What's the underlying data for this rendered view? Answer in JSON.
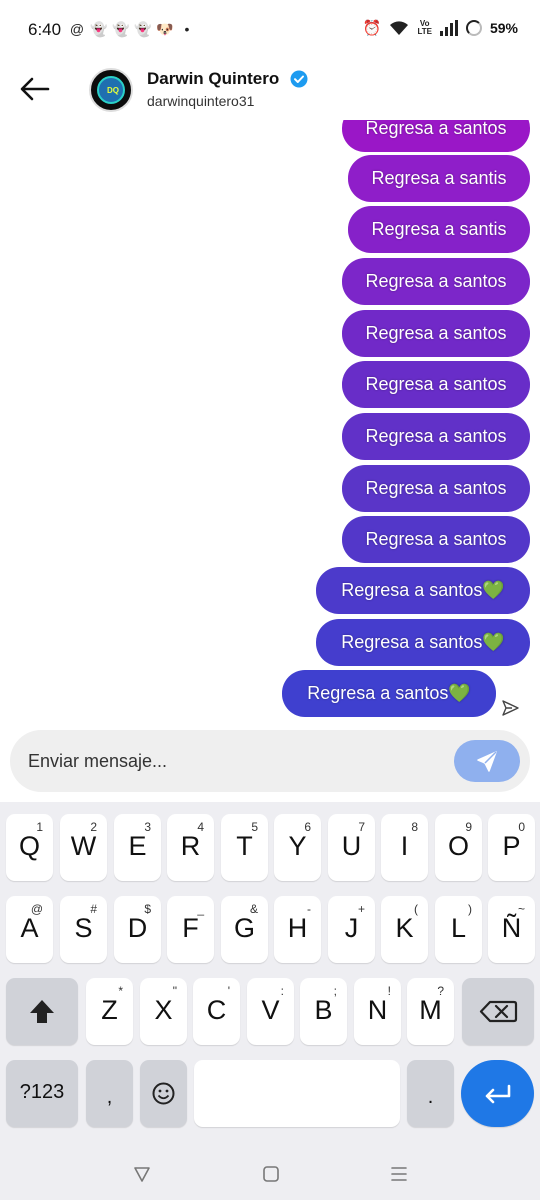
{
  "status_bar": {
    "time": "6:40",
    "notification_icons": [
      "threads-icon",
      "snapchat-icon",
      "snapchat-icon",
      "snapchat-icon",
      "dog-icon",
      "dot-icon"
    ],
    "volte_label": "Vo\nLTE",
    "battery": "59%"
  },
  "header": {
    "contact_name": "Darwin Quintero",
    "handle": "darwinquintero31",
    "verified": true
  },
  "messages": [
    {
      "text": "Regresa a santos",
      "color": "#9a17c7"
    },
    {
      "text": "Regresa a santis",
      "color": "#8f1ec9"
    },
    {
      "text": "Regresa a santis",
      "color": "#8621c9"
    },
    {
      "text": "Regresa a santos",
      "color": "#7c26c9"
    },
    {
      "text": "Regresa a santos",
      "color": "#7129c8"
    },
    {
      "text": "Regresa a santos",
      "color": "#682dc8"
    },
    {
      "text": "Regresa a santos",
      "color": "#6131c8"
    },
    {
      "text": "Regresa a santos",
      "color": "#5a35c8"
    },
    {
      "text": "Regresa a santos",
      "color": "#5337c9"
    },
    {
      "text": "Regresa a santos💚",
      "color": "#4c3acb"
    },
    {
      "text": "Regresa a santos💚",
      "color": "#453dcd"
    },
    {
      "text": "Regresa a santos💚",
      "color": "#3f40cf"
    }
  ],
  "composer": {
    "placeholder": "Enviar mensaje..."
  },
  "keyboard": {
    "row1": [
      [
        "Q",
        "1"
      ],
      [
        "W",
        "2"
      ],
      [
        "E",
        "3"
      ],
      [
        "R",
        "4"
      ],
      [
        "T",
        "5"
      ],
      [
        "Y",
        "6"
      ],
      [
        "U",
        "7"
      ],
      [
        "I",
        "8"
      ],
      [
        "O",
        "9"
      ],
      [
        "P",
        "0"
      ]
    ],
    "row2": [
      [
        "A",
        "@"
      ],
      [
        "S",
        "#"
      ],
      [
        "D",
        "$"
      ],
      [
        "F",
        "_"
      ],
      [
        "G",
        "&"
      ],
      [
        "H",
        "-"
      ],
      [
        "J",
        "+"
      ],
      [
        "K",
        "("
      ],
      [
        "L",
        ")"
      ],
      [
        "Ñ",
        "~"
      ]
    ],
    "row3": [
      [
        "Z",
        "*"
      ],
      [
        "X",
        "\""
      ],
      [
        "C",
        "'"
      ],
      [
        "V",
        ":"
      ],
      [
        "B",
        ";"
      ],
      [
        "N",
        "!"
      ],
      [
        "M",
        "?"
      ]
    ],
    "symbols_label": "?123",
    "comma": ",",
    "period": "."
  }
}
